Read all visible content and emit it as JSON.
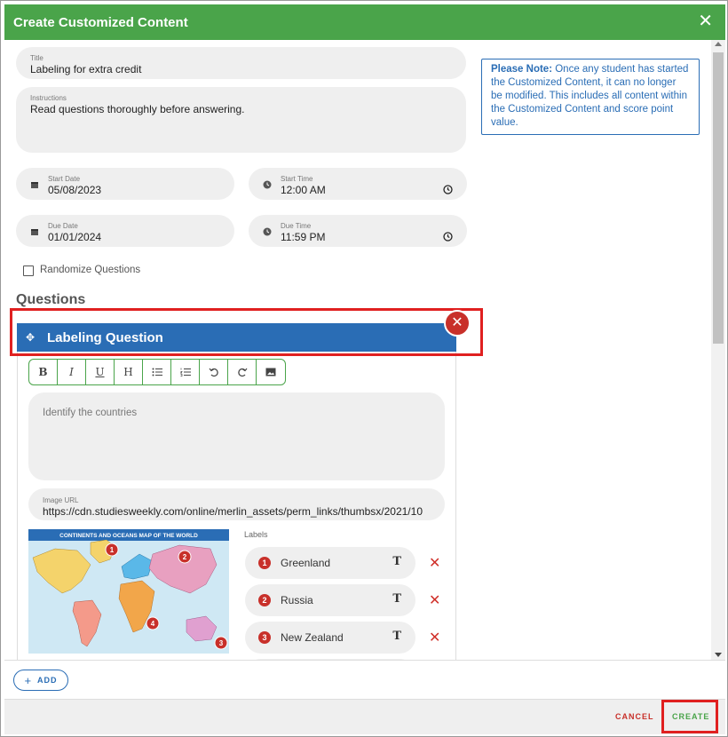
{
  "dialog": {
    "title": "Create Customized Content"
  },
  "form": {
    "title": {
      "label": "Title",
      "value": "Labeling for extra credit"
    },
    "instructions": {
      "label": "Instructions",
      "value": "Read questions thoroughly before answering."
    },
    "start_date": {
      "label": "Start Date",
      "value": "05/08/2023"
    },
    "start_time": {
      "label": "Start Time",
      "value": "12:00 AM"
    },
    "due_date": {
      "label": "Due Date",
      "value": "01/01/2024"
    },
    "due_time": {
      "label": "Due Time",
      "value": "11:59 PM"
    },
    "randomize": {
      "label": "Randomize Questions",
      "checked": false
    }
  },
  "note": {
    "bold": "Please Note:",
    "text": " Once any student has started the Customized Content, it can no longer be modified. This includes all content within the Customized Content and score point value."
  },
  "questions": {
    "heading": "Questions",
    "question": {
      "title": "Labeling Question",
      "toolbar": [
        "B",
        "I",
        "U",
        "H",
        "bullet-list",
        "numbered-list",
        "undo",
        "redo",
        "image"
      ],
      "text_placeholder": "Identify the countries",
      "image_url": {
        "label": "Image URL",
        "value": "https://cdn.studiesweekly.com/online/merlin_assets/perm_links/thumbsx/2021/10"
      },
      "map_title": "CONTINENTS AND OCEANS MAP OF THE WORLD",
      "labels_header": "Labels",
      "labels": [
        {
          "num": "1",
          "text": "Greenland"
        },
        {
          "num": "2",
          "text": "Russia"
        },
        {
          "num": "3",
          "text": "New Zealand"
        }
      ]
    }
  },
  "footer": {
    "add": "ADD",
    "cancel": "CANCEL",
    "create": "CREATE"
  },
  "colors": {
    "header": "#4aa44a",
    "accent": "#2a6db5",
    "danger": "#c8302a"
  }
}
